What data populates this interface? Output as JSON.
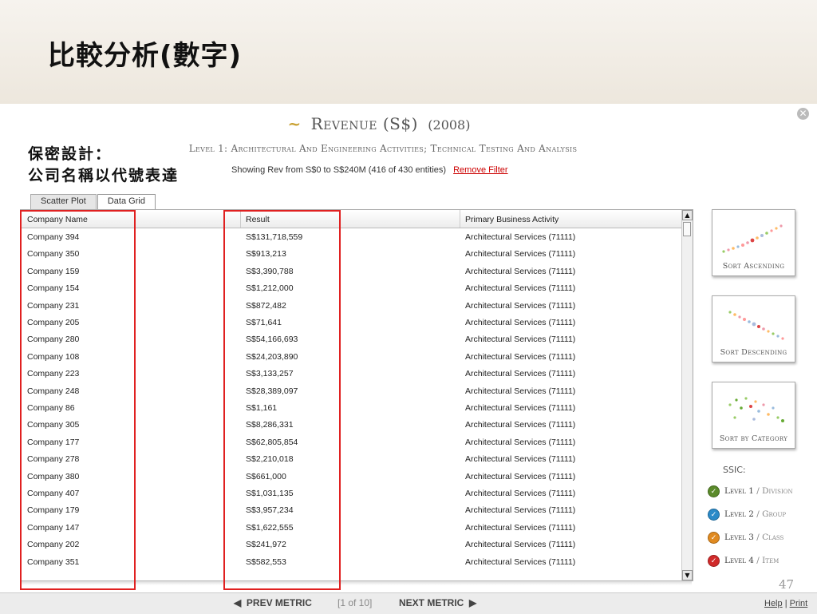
{
  "slide": {
    "title": "比較分析(數字)",
    "page_number": "47"
  },
  "note": {
    "line1": "保密設計：",
    "line2": "公司名稱以代號表達"
  },
  "metric": {
    "tilde": "~",
    "name": "Revenue (S$)",
    "year": "(2008)",
    "level_line": "Level 1: Architectural And Engineering Activities; Technical Testing And Analysis",
    "filter_text": "Showing Rev from S$0 to S$240M (416 of 430 entities)",
    "remove_filter": "Remove Filter"
  },
  "tabs": [
    {
      "label": "Scatter Plot",
      "active": false
    },
    {
      "label": "Data Grid",
      "active": true
    }
  ],
  "grid": {
    "columns": [
      "Company Name",
      "Result",
      "Primary Business Activity"
    ],
    "rows": [
      [
        "Company 394",
        "S$131,718,559",
        "Architectural Services (71111)"
      ],
      [
        "Company 350",
        "S$913,213",
        "Architectural Services (71111)"
      ],
      [
        "Company 159",
        "S$3,390,788",
        "Architectural Services (71111)"
      ],
      [
        "Company 154",
        "S$1,212,000",
        "Architectural Services (71111)"
      ],
      [
        "Company 231",
        "S$872,482",
        "Architectural Services (71111)"
      ],
      [
        "Company 205",
        "S$71,641",
        "Architectural Services (71111)"
      ],
      [
        "Company 280",
        "S$54,166,693",
        "Architectural Services (71111)"
      ],
      [
        "Company 108",
        "S$24,203,890",
        "Architectural Services (71111)"
      ],
      [
        "Company 223",
        "S$3,133,257",
        "Architectural Services (71111)"
      ],
      [
        "Company 248",
        "S$28,389,097",
        "Architectural Services (71111)"
      ],
      [
        "Company 86",
        "S$1,161",
        "Architectural Services (71111)"
      ],
      [
        "Company 305",
        "S$8,286,331",
        "Architectural Services (71111)"
      ],
      [
        "Company 177",
        "S$62,805,854",
        "Architectural Services (71111)"
      ],
      [
        "Company 278",
        "S$2,210,018",
        "Architectural Services (71111)"
      ],
      [
        "Company 380",
        "S$661,000",
        "Architectural Services (71111)"
      ],
      [
        "Company 407",
        "S$1,031,135",
        "Architectural Services (71111)"
      ],
      [
        "Company 179",
        "S$3,957,234",
        "Architectural Services (71111)"
      ],
      [
        "Company 147",
        "S$1,622,555",
        "Architectural Services (71111)"
      ],
      [
        "Company 202",
        "S$241,972",
        "Architectural Services (71111)"
      ],
      [
        "Company 351",
        "S$582,553",
        "Architectural Services (71111)"
      ]
    ]
  },
  "sort": {
    "ascending": "Sort Ascending",
    "descending": "Sort Descending",
    "category": "Sort by Category"
  },
  "ssic": {
    "title": "SSIC:",
    "levels": [
      {
        "level": "Level 1",
        "name": "Division",
        "color": "#5a8a2a",
        "mark": "✓"
      },
      {
        "level": "Level 2",
        "name": "Group",
        "color": "#2a8ac8",
        "mark": "✓"
      },
      {
        "level": "Level 3",
        "name": "Class",
        "color": "#e08a20",
        "mark": "✓"
      },
      {
        "level": "Level 4",
        "name": "Item",
        "color": "#d02a2a",
        "mark": "✓"
      }
    ]
  },
  "footer": {
    "prev": "PREV METRIC",
    "pager": "[1 of 10]",
    "next": "NEXT METRIC",
    "help": "Help",
    "sep": "|",
    "print": "Print"
  }
}
